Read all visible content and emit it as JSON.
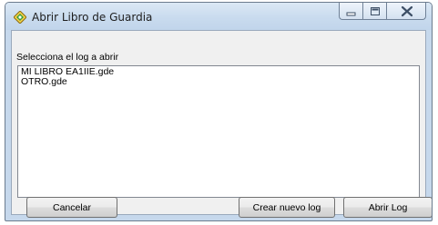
{
  "window": {
    "title": "Abrir Libro de Guardia",
    "icon": "app-icon"
  },
  "dialog": {
    "prompt": "Selecciona el log a abrir",
    "logs": [
      {
        "name": "MI LIBRO EA1IIE.gde"
      },
      {
        "name": "OTRO.gde"
      }
    ]
  },
  "buttons": {
    "cancel": "Cancelar",
    "new_log": "Crear nuevo log",
    "open_log": "Abrir Log"
  },
  "colors": {
    "titlebar": "#c9dbee",
    "client": "#f0f0f0",
    "border": "#6c7c8e"
  }
}
